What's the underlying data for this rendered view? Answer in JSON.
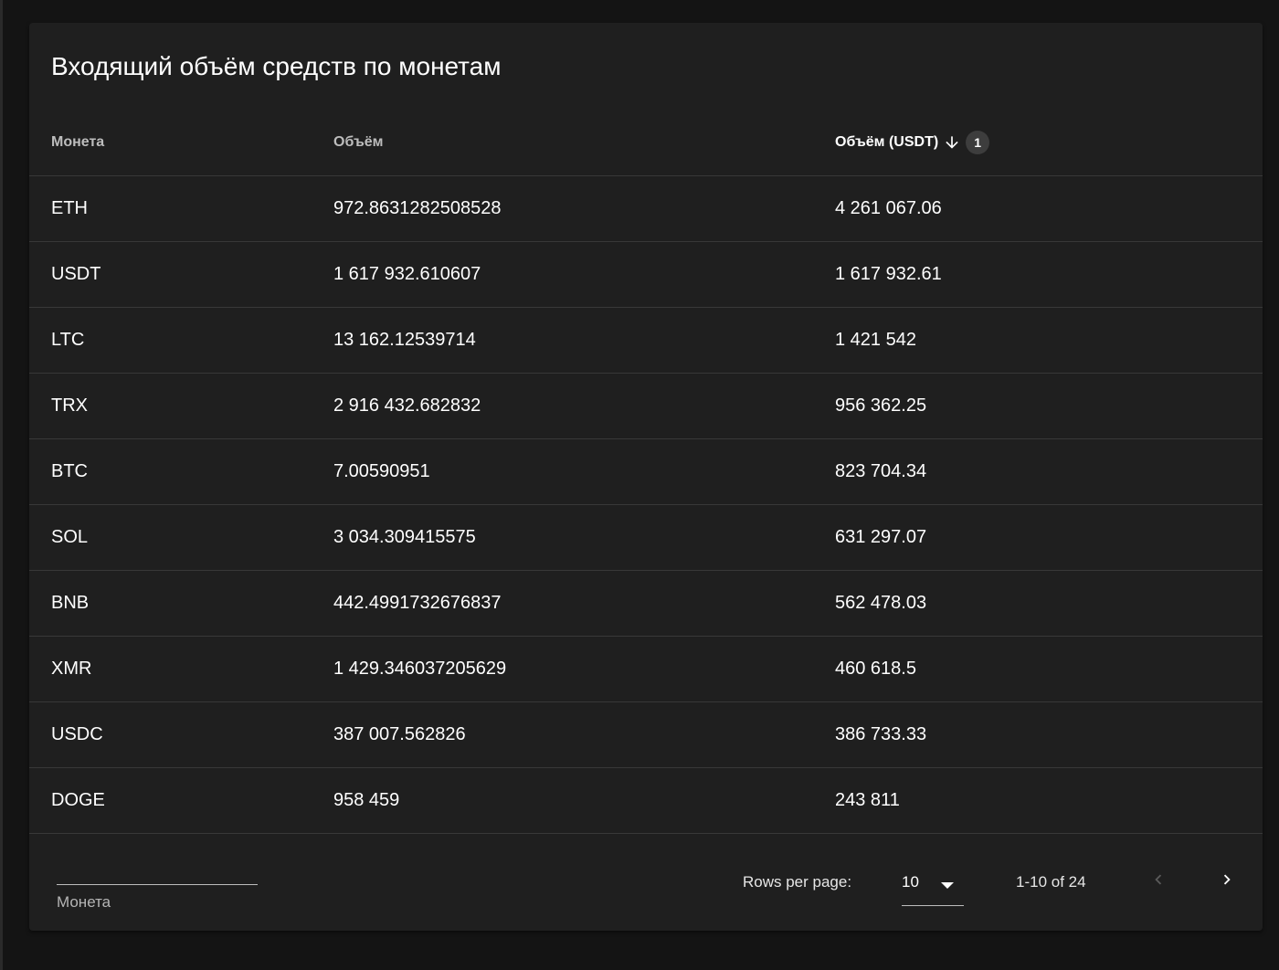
{
  "title": "Входящий объём средств по монетам",
  "table": {
    "columns": [
      "Монета",
      "Объём",
      "Объём (USDT)"
    ],
    "sort_badge": "1",
    "rows": [
      {
        "coin": "ETH",
        "volume": "972.8631282508528",
        "volume_usdt": "4 261 067.06"
      },
      {
        "coin": "USDT",
        "volume": "1 617 932.610607",
        "volume_usdt": "1 617 932.61"
      },
      {
        "coin": "LTC",
        "volume": "13 162.12539714",
        "volume_usdt": "1 421 542"
      },
      {
        "coin": "TRX",
        "volume": "2 916 432.682832",
        "volume_usdt": "956 362.25"
      },
      {
        "coin": "BTC",
        "volume": "7.00590951",
        "volume_usdt": "823 704.34"
      },
      {
        "coin": "SOL",
        "volume": "3 034.309415575",
        "volume_usdt": "631 297.07"
      },
      {
        "coin": "BNB",
        "volume": "442.4991732676837",
        "volume_usdt": "562 478.03"
      },
      {
        "coin": "XMR",
        "volume": "1 429.346037205629",
        "volume_usdt": "460 618.5"
      },
      {
        "coin": "USDC",
        "volume": "387 007.562826",
        "volume_usdt": "386 733.33"
      },
      {
        "coin": "DOGE",
        "volume": "958 459",
        "volume_usdt": "243 811"
      }
    ]
  },
  "footer": {
    "filter_label": "Монета",
    "rows_per_page_label": "Rows per page:",
    "rows_per_page_value": "10",
    "range": "1-10 of 24"
  },
  "icons": {
    "sort": "arrow-down-icon",
    "dropdown": "caret-down-icon",
    "prev": "chevron-left-icon",
    "next": "chevron-right-icon"
  },
  "colors": {
    "background": "#141414",
    "card": "#1f1f1f",
    "divider": "#383838",
    "text": "#ffffff",
    "muted": "#bdbdbd"
  }
}
